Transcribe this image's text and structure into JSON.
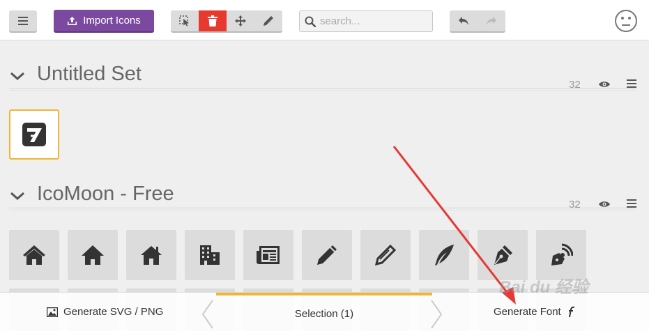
{
  "toolbar": {
    "menu_icon": "hamburger-icon",
    "import_label": "Import Icons",
    "import_icon": "upload-icon",
    "tools": [
      {
        "name": "select-tool",
        "icon": "select-cursor-icon",
        "active": false
      },
      {
        "name": "delete-tool",
        "icon": "trash-icon",
        "active": true
      },
      {
        "name": "move-tool",
        "icon": "move-arrows-icon",
        "active": false
      },
      {
        "name": "edit-tool",
        "icon": "pencil-icon",
        "active": false
      }
    ],
    "search_placeholder": "search...",
    "undo_icon": "undo-icon",
    "redo_icon": "redo-icon",
    "account_icon": "smiley-icon"
  },
  "sets": [
    {
      "title": "Untitled Set",
      "count": "32"
    },
    {
      "title": "IcoMoon - Free",
      "count": "32"
    }
  ],
  "icomoon_glyphs": [
    "home",
    "home2",
    "home3",
    "office",
    "newspaper",
    "pencil",
    "pencil2",
    "quill",
    "pen",
    "blog"
  ],
  "bottom": {
    "generate_svg_label": "Generate SVG / PNG",
    "selection_label": "Selection (1)",
    "generate_font_label": "Generate Font"
  },
  "watermark": "Bai du 经验",
  "colors": {
    "accent_purple": "#7b4aa0",
    "delete_red": "#e8392f",
    "selection_yellow": "#f0b533",
    "annotation_arrow": "#e53935"
  }
}
